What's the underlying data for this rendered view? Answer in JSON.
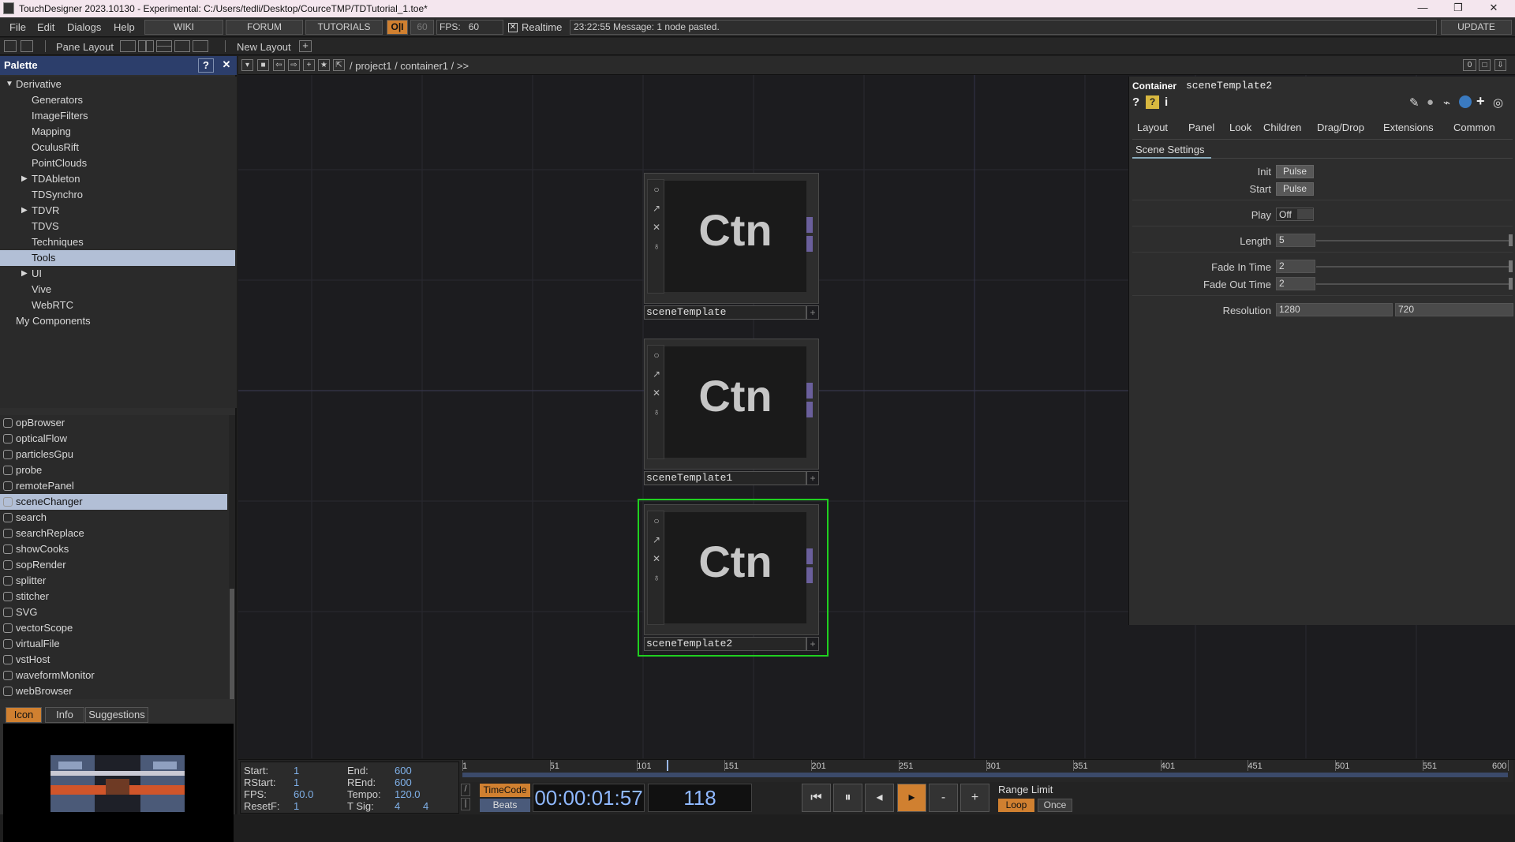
{
  "titlebar": {
    "title": "TouchDesigner 2023.10130 - Experimental: C:/Users/tedli/Desktop/CourceTMP/TDTutorial_1.toe*",
    "min": "—",
    "max": "❐",
    "close": "✕"
  },
  "menubar": {
    "items": [
      "File",
      "Edit",
      "Dialogs",
      "Help"
    ],
    "wiki": "WIKI",
    "forum": "FORUM",
    "tutorials": "TUTORIALS",
    "oi": "O|I",
    "sixty": "60",
    "fps_label": "FPS:",
    "fps_value": "60",
    "realtime": "Realtime",
    "message": "23:22:55 Message: 1 node pasted.",
    "update": "UPDATE"
  },
  "layoutbar": {
    "pane_layout": "Pane Layout",
    "new_layout": "New Layout"
  },
  "palette": {
    "title": "Palette",
    "help": "?",
    "close": "✕",
    "tree": [
      {
        "label": "Derivative",
        "indent": 0,
        "arrow": "down"
      },
      {
        "label": "Generators",
        "indent": 2,
        "arrow": ""
      },
      {
        "label": "ImageFilters",
        "indent": 2,
        "arrow": ""
      },
      {
        "label": "Mapping",
        "indent": 2,
        "arrow": ""
      },
      {
        "label": "OculusRift",
        "indent": 2,
        "arrow": ""
      },
      {
        "label": "PointClouds",
        "indent": 2,
        "arrow": ""
      },
      {
        "label": "TDAbleton",
        "indent": 2,
        "arrow": "right"
      },
      {
        "label": "TDSynchro",
        "indent": 2,
        "arrow": ""
      },
      {
        "label": "TDVR",
        "indent": 2,
        "arrow": "right"
      },
      {
        "label": "TDVS",
        "indent": 2,
        "arrow": ""
      },
      {
        "label": "Techniques",
        "indent": 2,
        "arrow": ""
      },
      {
        "label": "Tools",
        "indent": 2,
        "arrow": "",
        "selected": true
      },
      {
        "label": "UI",
        "indent": 2,
        "arrow": "right"
      },
      {
        "label": "Vive",
        "indent": 2,
        "arrow": ""
      },
      {
        "label": "WebRTC",
        "indent": 2,
        "arrow": ""
      },
      {
        "label": "My Components",
        "indent": 1,
        "arrow": ""
      }
    ],
    "ops": [
      "opBrowser",
      "opticalFlow",
      "particlesGpu",
      "probe",
      "remotePanel",
      "sceneChanger",
      "search",
      "searchReplace",
      "showCooks",
      "sopRender",
      "splitter",
      "stitcher",
      "SVG",
      "vectorScope",
      "virtualFile",
      "vstHost",
      "waveformMonitor",
      "webBrowser"
    ],
    "selected_op": "sceneChanger",
    "tabs": [
      "Icon",
      "Info",
      "Suggestions"
    ],
    "active_tab": "Icon"
  },
  "network": {
    "path": "/ project1 / container1 / >>",
    "zero": "0",
    "ctn_text": "Ctn",
    "nodes": [
      {
        "name": "sceneTemplate",
        "selected": false
      },
      {
        "name": "sceneTemplate1",
        "selected": false
      },
      {
        "name": "sceneTemplate2",
        "selected": true
      }
    ]
  },
  "params": {
    "type": "Container",
    "name": "sceneTemplate2",
    "tabs": [
      "Layout",
      "Panel",
      "Look",
      "Children",
      "Drag/Drop",
      "Extensions",
      "Common"
    ],
    "section": "Scene Settings",
    "init_label": "Init",
    "init_btn": "Pulse",
    "start_label": "Start",
    "start_btn": "Pulse",
    "play_label": "Play",
    "play_value": "Off",
    "length_label": "Length",
    "length_value": "5",
    "fadein_label": "Fade In Time",
    "fadein_value": "2",
    "fadeout_label": "Fade Out Time",
    "fadeout_value": "2",
    "res_label": "Resolution",
    "res_w": "1280",
    "res_h": "720"
  },
  "timeline": {
    "start_k": "Start:",
    "start_v": "1",
    "end_k": "End:",
    "end_v": "600",
    "rstart_k": "RStart:",
    "rstart_v": "1",
    "rend_k": "REnd:",
    "rend_v": "600",
    "fps_k": "FPS:",
    "fps_v": "60.0",
    "tempo_k": "Tempo:",
    "tempo_v": "120.0",
    "resetf_k": "ResetF:",
    "resetf_v": "1",
    "tsig_k": "T Sig:",
    "tsig_v1": "4",
    "tsig_v2": "4",
    "ticks": [
      "1",
      "51",
      "101",
      "151",
      "201",
      "251",
      "301",
      "351",
      "401",
      "451",
      "501",
      "551",
      "600"
    ],
    "timecode_btn": "TimeCode",
    "beats_btn": "Beats",
    "timecode": "00:00:01:57",
    "frame": "118",
    "range_limit": "Range Limit",
    "loop": "Loop",
    "once": "Once",
    "minus": "-",
    "plus": "+"
  }
}
